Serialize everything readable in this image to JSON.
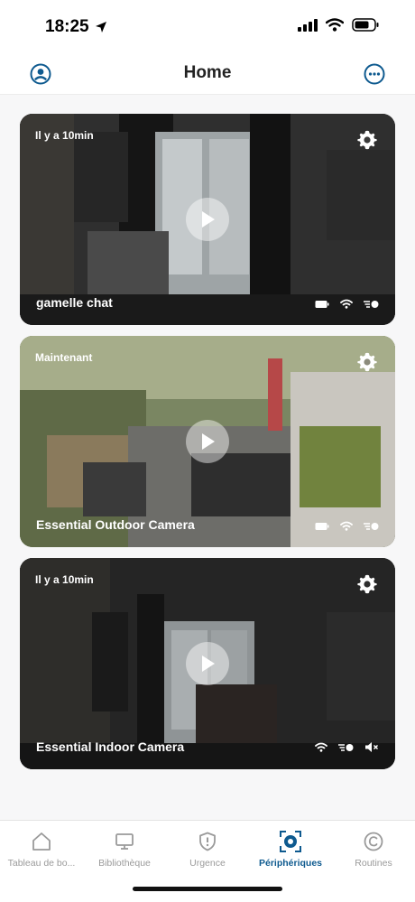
{
  "status_bar": {
    "time": "18:25"
  },
  "nav": {
    "title": "Home"
  },
  "cameras": [
    {
      "time_label": "Il y a 10min",
      "name": "gamelle chat"
    },
    {
      "time_label": "Maintenant",
      "name": "Essential Outdoor Camera"
    },
    {
      "time_label": "Il y a 10min",
      "name": "Essential Indoor Camera"
    }
  ],
  "tabs": [
    {
      "label": "Tableau de bo...",
      "icon": "house-icon"
    },
    {
      "label": "Bibliothèque",
      "icon": "monitor-icon"
    },
    {
      "label": "Urgence",
      "icon": "shield-alert-icon"
    },
    {
      "label": "Périphériques",
      "icon": "camera-devices-icon",
      "active": true
    },
    {
      "label": "Routines",
      "icon": "routines-icon"
    }
  ],
  "colors": {
    "accent": "#0e5a8f",
    "inactive_tab": "#9a9a9a"
  }
}
